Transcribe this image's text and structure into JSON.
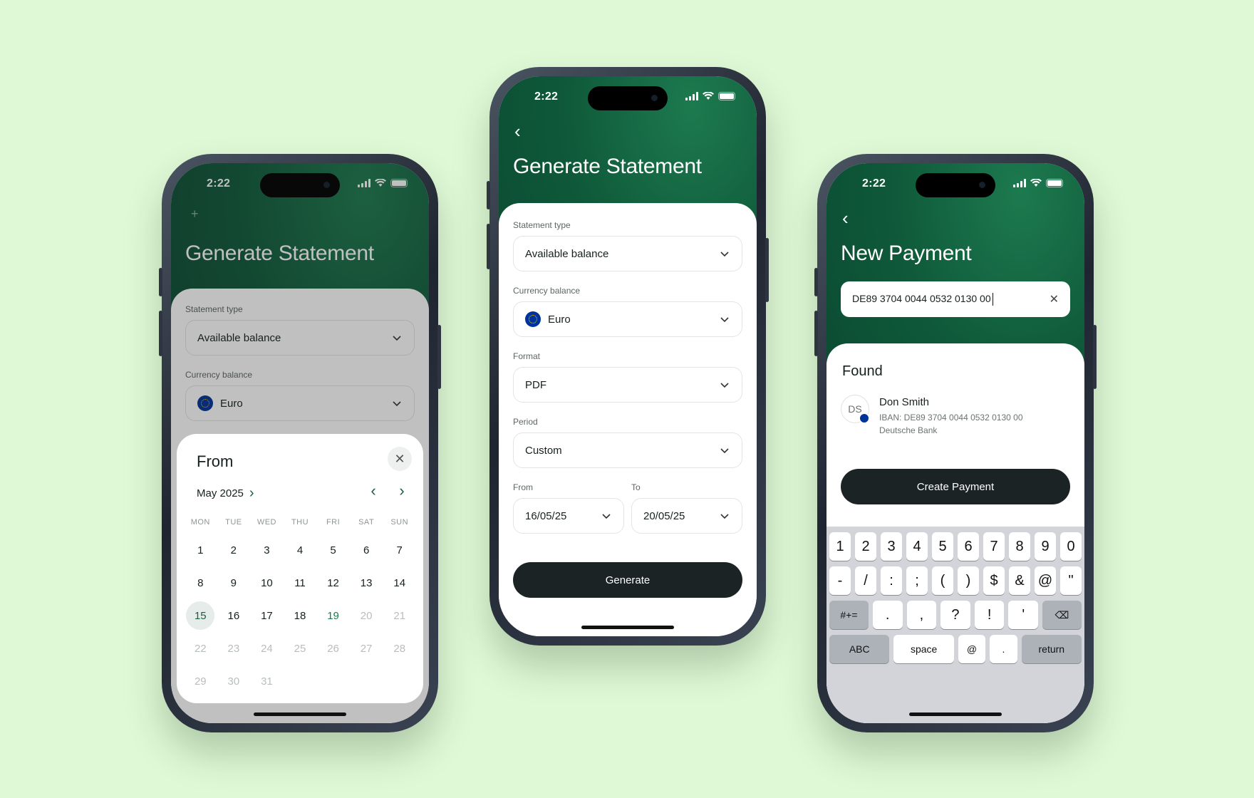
{
  "status": {
    "time": "2:22"
  },
  "phone1": {
    "title": "Generate Statement",
    "back_icon": "+",
    "statement_type_label": "Statement type",
    "statement_type_value": "Available balance",
    "currency_label": "Currency balance",
    "currency_value": "Euro",
    "calendar": {
      "title": "From",
      "close": "✕",
      "month": "May 2025",
      "month_chev": "›",
      "prev": "‹",
      "next": "›",
      "weekdays": [
        "MON",
        "TUE",
        "WED",
        "THU",
        "FRI",
        "SAT",
        "SUN"
      ],
      "days": [
        "1",
        "2",
        "3",
        "4",
        "5",
        "6",
        "7",
        "8",
        "9",
        "10",
        "11",
        "12",
        "13",
        "14",
        "15",
        "16",
        "17",
        "18",
        "19",
        "20",
        "21",
        "22",
        "23",
        "24",
        "25",
        "26",
        "27",
        "28",
        "29",
        "30",
        "31"
      ],
      "selected_day": "15",
      "today_day": "19",
      "first_muted_day": "20"
    }
  },
  "phone2": {
    "title": "Generate Statement",
    "back_icon": "‹",
    "statement_type_label": "Statement type",
    "statement_type_value": "Available balance",
    "currency_label": "Currency balance",
    "currency_value": "Euro",
    "format_label": "Format",
    "format_value": "PDF",
    "period_label": "Period",
    "period_value": "Custom",
    "from_label": "From",
    "from_value": "16/05/25",
    "to_label": "To",
    "to_value": "20/05/25",
    "generate_button": "Generate"
  },
  "phone3": {
    "title": "New Payment",
    "back_icon": "‹",
    "search_value": "DE89 3704 0044 0532 0130 00",
    "clear_icon": "✕",
    "found_heading": "Found",
    "contact": {
      "initials": "DS",
      "name": "Don Smith",
      "iban": "IBAN: DE89 3704 0044 0532 0130 00",
      "bank": "Deutsche Bank"
    },
    "create_button": "Create Payment",
    "keyboard": {
      "row1": [
        "1",
        "2",
        "3",
        "4",
        "5",
        "6",
        "7",
        "8",
        "9",
        "0"
      ],
      "row2": [
        "-",
        "/",
        ":",
        ";",
        "(",
        ")",
        "$",
        "&",
        "@",
        "\""
      ],
      "row3_left": "#+=",
      "row3": [
        ".",
        ",",
        "?",
        "!",
        "'"
      ],
      "row3_right": "⌫",
      "abc": "ABC",
      "space": "space",
      "at": "@",
      "dot": ".",
      "return": "return"
    }
  }
}
